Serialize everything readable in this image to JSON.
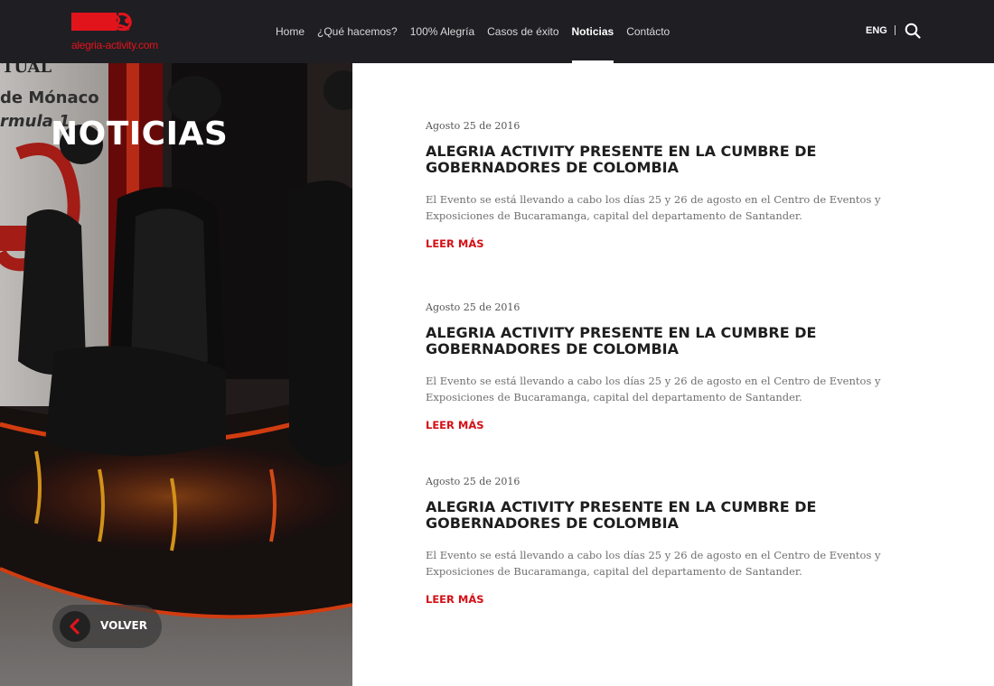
{
  "header": {
    "logo_text": "alegria-activity.com",
    "nav": [
      {
        "label": "Home"
      },
      {
        "label": "¿Qué hacemos?"
      },
      {
        "label": "100% Alegría"
      },
      {
        "label": "Casos de éxito"
      },
      {
        "label": "Noticias",
        "active": true
      },
      {
        "label": "Contácto"
      }
    ],
    "lang": "ENG",
    "search_icon": "search-icon"
  },
  "hero": {
    "title": "NOTICIAS",
    "sign_lines": [
      "TUAL",
      "de Mónaco",
      "rmula 1"
    ],
    "back_label": "VOLVER",
    "back_icon": "chevron-left-icon"
  },
  "articles": [
    {
      "date": "Agosto 25 de 2016",
      "title": "ALEGRIA ACTIVITY PRESENTE EN LA CUMBRE DE GOBERNADORES DE COLOMBIA",
      "excerpt": "El Evento se está llevando a cabo los días 25 y 26 de agosto en el Centro de Eventos y Exposiciones de Bucaramanga, capital del departamento de Santander.",
      "more": "LEER MÁS"
    },
    {
      "date": "Agosto 25 de 2016",
      "title": "ALEGRIA ACTIVITY PRESENTE EN LA CUMBRE DE GOBERNADORES DE COLOMBIA",
      "excerpt": "El Evento se está llevando a cabo los días 25 y 26 de agosto en el Centro de Eventos y Exposiciones de Bucaramanga, capital del departamento de Santander.",
      "more": "LEER MÁS"
    },
    {
      "date": "Agosto 25 de 2016",
      "title": "ALEGRIA ACTIVITY PRESENTE EN LA CUMBRE DE GOBERNADORES DE COLOMBIA",
      "excerpt": "El Evento se está llevando a cabo los días 25 y 26 de agosto en el Centro de Eventos y Exposiciones de Bucaramanga, capital del departamento de Santander.",
      "more": "LEER MÁS"
    }
  ],
  "colors": {
    "header_bg": "#1f1e23",
    "accent": "#d40f16",
    "title": "#1e1e1e",
    "body_text": "#6f6f6f"
  }
}
